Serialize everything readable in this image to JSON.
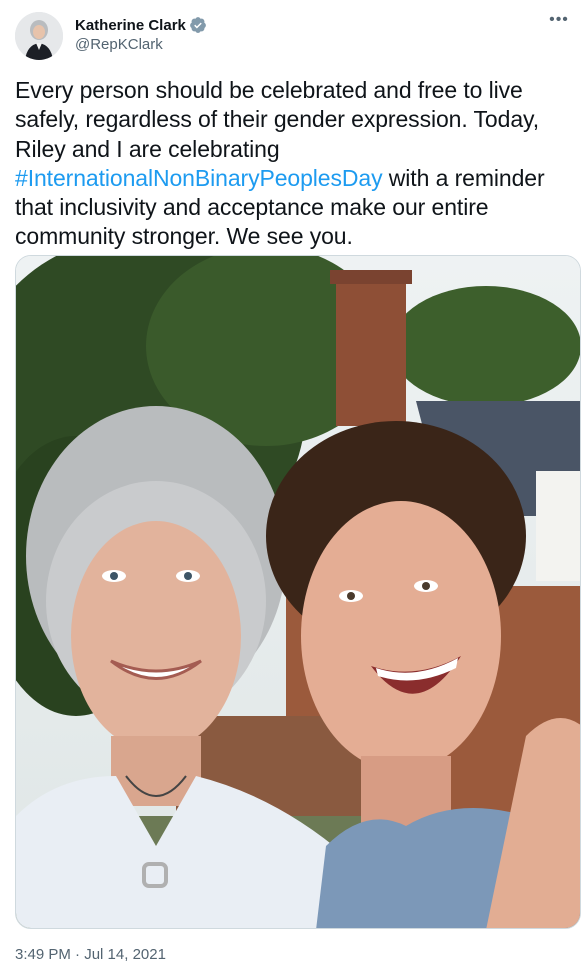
{
  "tweet": {
    "author": {
      "display_name": "Katherine Clark",
      "handle": "@RepKClark",
      "verified_icon": "verified-badge-icon",
      "avatar_icon": "avatar"
    },
    "more_icon": "more-options-icon",
    "text": {
      "before_hashtag": "Every person should be celebrated and free to live safely, regardless of their gender expression. Today, Riley and I are celebrating ",
      "hashtag": "#InternationalNonBinaryPeoplesDay",
      "after_hashtag": " with a reminder that inclusivity and acceptance make our entire community stronger. We see you."
    },
    "media": {
      "type": "photo"
    },
    "time": "3:49 PM",
    "separator": "·",
    "date": "Jul 14, 2021"
  },
  "colors": {
    "text": "#0f1419",
    "secondary": "#536471",
    "link": "#1d9bf0",
    "verified": "#829aab"
  }
}
